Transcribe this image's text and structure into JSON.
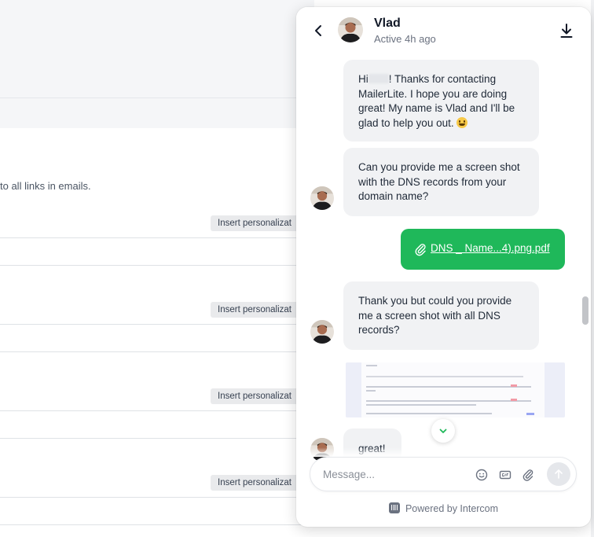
{
  "background": {
    "hint_text": "to all links in emails.",
    "insert_button_label": "Insert personalizat"
  },
  "chat": {
    "agent_name": "Vlad",
    "agent_status": "Active 4h ago",
    "messages": [
      {
        "from": "agent",
        "part1": "Hi",
        "part2": "! Thanks for contacting MailerLite. I hope you are doing great! My name is Vlad and I'll be glad to help you out."
      },
      {
        "from": "agent",
        "text": "Can you provide me a screen shot with the DNS records from your domain name?"
      },
      {
        "from": "user",
        "file_name": "DNS _ Name...4).png.pdf"
      },
      {
        "from": "agent",
        "text": "Thank you but could you provide me a screen shot with all DNS records?"
      },
      {
        "from": "user",
        "attachment": "screenshot-image"
      },
      {
        "from": "agent",
        "text": "great!"
      }
    ],
    "composer_placeholder": "Message...",
    "powered_by": "Powered by Intercom"
  },
  "icons": {
    "back": "chevron-left-icon",
    "download": "download-icon",
    "emoji": "smiley-icon",
    "gif": "gif-icon",
    "attach": "paperclip-icon",
    "send": "send-icon",
    "scroll_down": "chevron-down-icon"
  },
  "colors": {
    "user_bubble": "#1fb85a",
    "agent_bubble": "#f1f2f4",
    "scroll_chevron": "#1fb85a"
  }
}
